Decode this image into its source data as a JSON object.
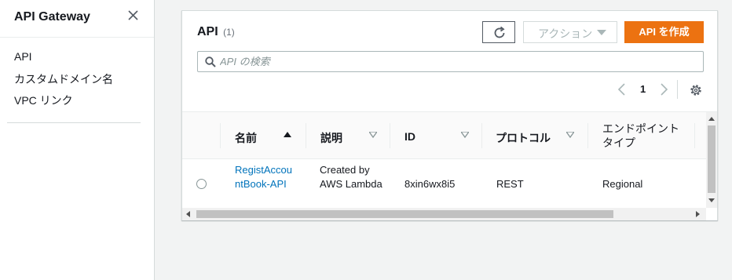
{
  "sidebar": {
    "title": "API Gateway",
    "items": [
      {
        "label": "API"
      },
      {
        "label": "カスタムドメイン名"
      },
      {
        "label": "VPC リンク"
      }
    ]
  },
  "panel": {
    "title": "API",
    "count": "(1)",
    "actions_label": "アクション",
    "create_label": "API を作成",
    "search_placeholder": "API の検索",
    "page_number": "1"
  },
  "table": {
    "columns": [
      {
        "label": "名前",
        "sort": "ascending"
      },
      {
        "label": "説明"
      },
      {
        "label": "ID"
      },
      {
        "label": "プロトコル"
      },
      {
        "label": "エンドポイント タイプ"
      }
    ],
    "rows": [
      {
        "name": "RegistAccountBook-API",
        "description": "Created by AWS Lambda",
        "id": "8xin6wx8i5",
        "protocol": "REST",
        "endpoint_type": "Regional"
      }
    ]
  },
  "colors": {
    "accent": "#ec7211",
    "link": "#0073bb"
  },
  "icons": [
    "close-icon",
    "refresh-icon",
    "caret-down-icon",
    "search-icon",
    "chevron-left-icon",
    "chevron-right-icon",
    "gear-icon",
    "sort-ascending-icon",
    "sort-icon"
  ]
}
